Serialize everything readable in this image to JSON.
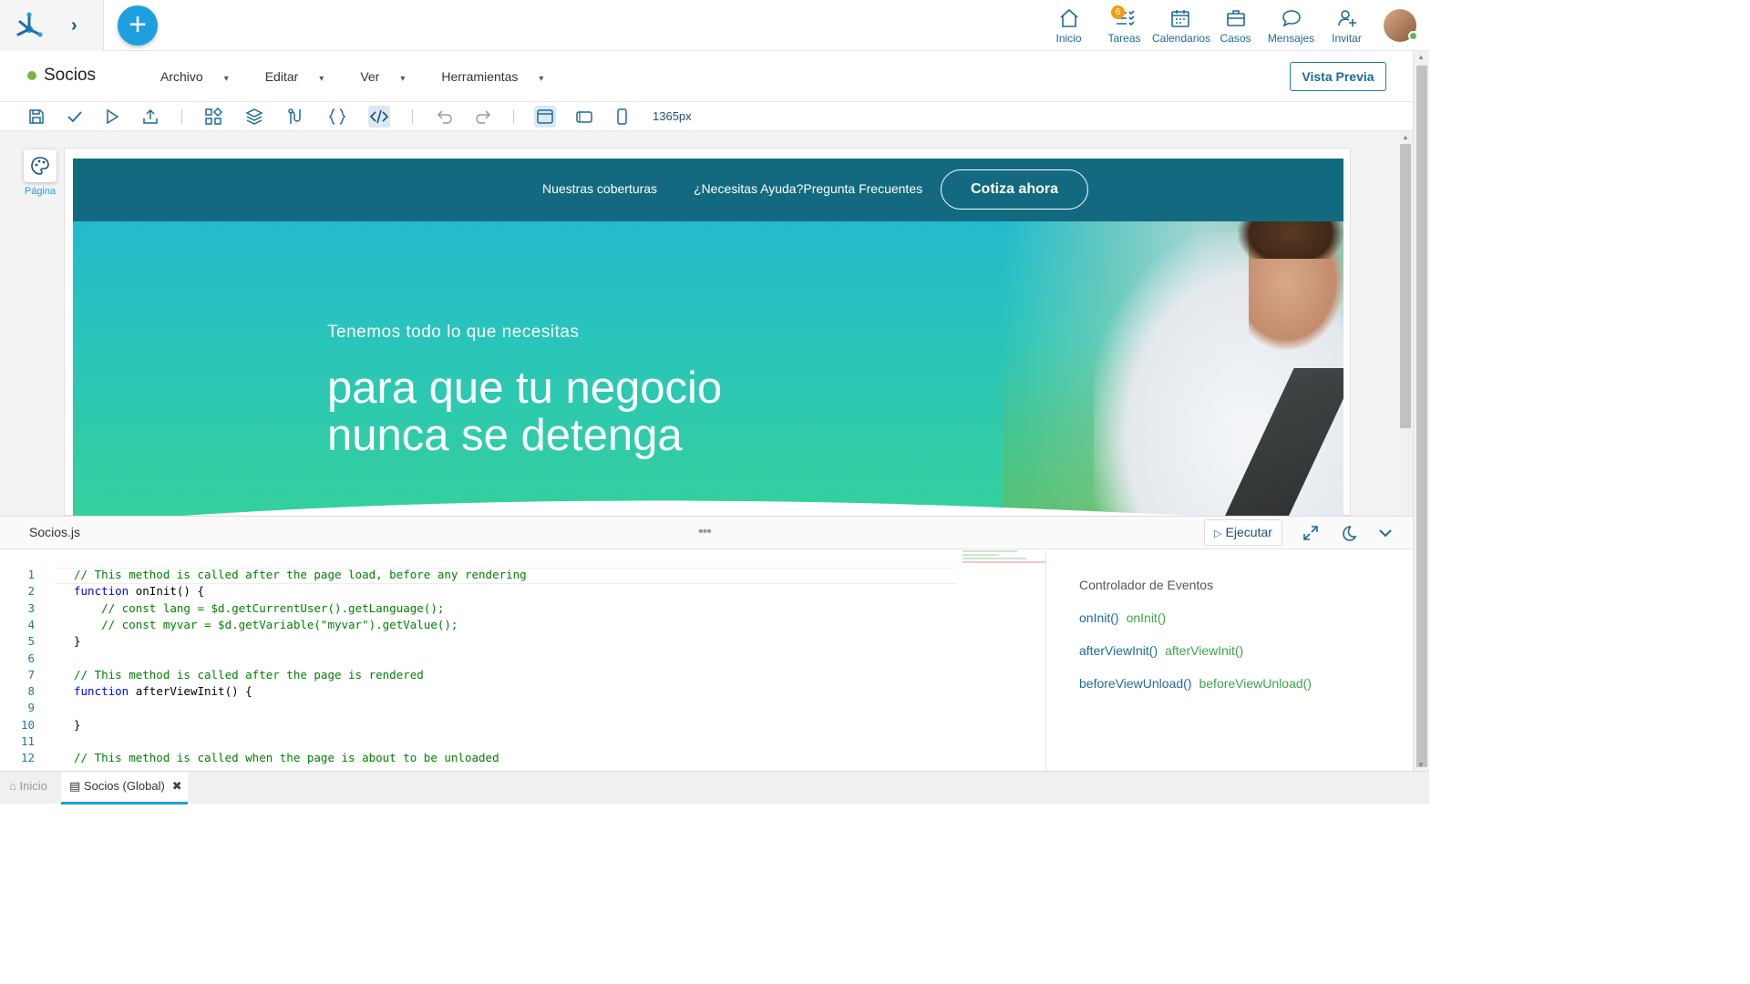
{
  "topbar": {
    "nav": [
      {
        "label": "Inicio",
        "icon": "home-icon"
      },
      {
        "label": "Tareas",
        "icon": "tasks-icon",
        "badge": "6"
      },
      {
        "label": "Calendarios",
        "icon": "calendar-icon"
      },
      {
        "label": "Casos",
        "icon": "briefcase-icon"
      },
      {
        "label": "Mensajes",
        "icon": "chat-icon"
      },
      {
        "label": "Invitar",
        "icon": "add-user-icon"
      }
    ],
    "plus_label": "+"
  },
  "menubar": {
    "title": "Socios",
    "menus": [
      "Archivo",
      "Editar",
      "Ver",
      "Herramientas"
    ],
    "preview_label": "Vista Previa"
  },
  "toolbar": {
    "width_label": "1365px"
  },
  "workspace": {
    "page_tool_label": "Página"
  },
  "site": {
    "nav1": "Nuestras coberturas",
    "nav2": "¿Necesitas Ayuda?Pregunta Frecuentes",
    "cta": "Cotiza ahora",
    "hero_sub": "Tenemos todo lo que necesitas",
    "hero_line1": "para que tu negocio",
    "hero_line2": "nunca se detenga"
  },
  "editor": {
    "file_name": "Socios.js",
    "run_label": "Ejecutar",
    "lines": [
      {
        "n": "1",
        "t": "// This method is called after the page load, before any rendering",
        "c": "cm"
      },
      {
        "n": "2",
        "t": "function onInit() {",
        "c": "fn"
      },
      {
        "n": "3",
        "t": "    // const lang = $d.getCurrentUser().getLanguage();",
        "c": "cm"
      },
      {
        "n": "4",
        "t": "    // const myvar = $d.getVariable(\"myvar\").getValue();",
        "c": "cm"
      },
      {
        "n": "5",
        "t": "}",
        "c": ""
      },
      {
        "n": "6",
        "t": "",
        "c": ""
      },
      {
        "n": "7",
        "t": "// This method is called after the page is rendered",
        "c": "cm"
      },
      {
        "n": "8",
        "t": "function afterViewInit() {",
        "c": "fn"
      },
      {
        "n": "9",
        "t": "",
        "c": ""
      },
      {
        "n": "10",
        "t": "}",
        "c": ""
      },
      {
        "n": "11",
        "t": "",
        "c": ""
      },
      {
        "n": "12",
        "t": "// This method is called when the page is about to be unloaded",
        "c": "cm"
      }
    ],
    "events_title": "Controlador de Eventos",
    "events": [
      {
        "a": "onInit()",
        "b": "onInit()"
      },
      {
        "a": "afterViewInit()",
        "b": "afterViewInit()"
      },
      {
        "a": "beforeViewUnload()",
        "b": "beforeViewUnload()"
      }
    ]
  },
  "bottom_tabs": {
    "home": "Inicio",
    "active": "Socios (Global)"
  }
}
